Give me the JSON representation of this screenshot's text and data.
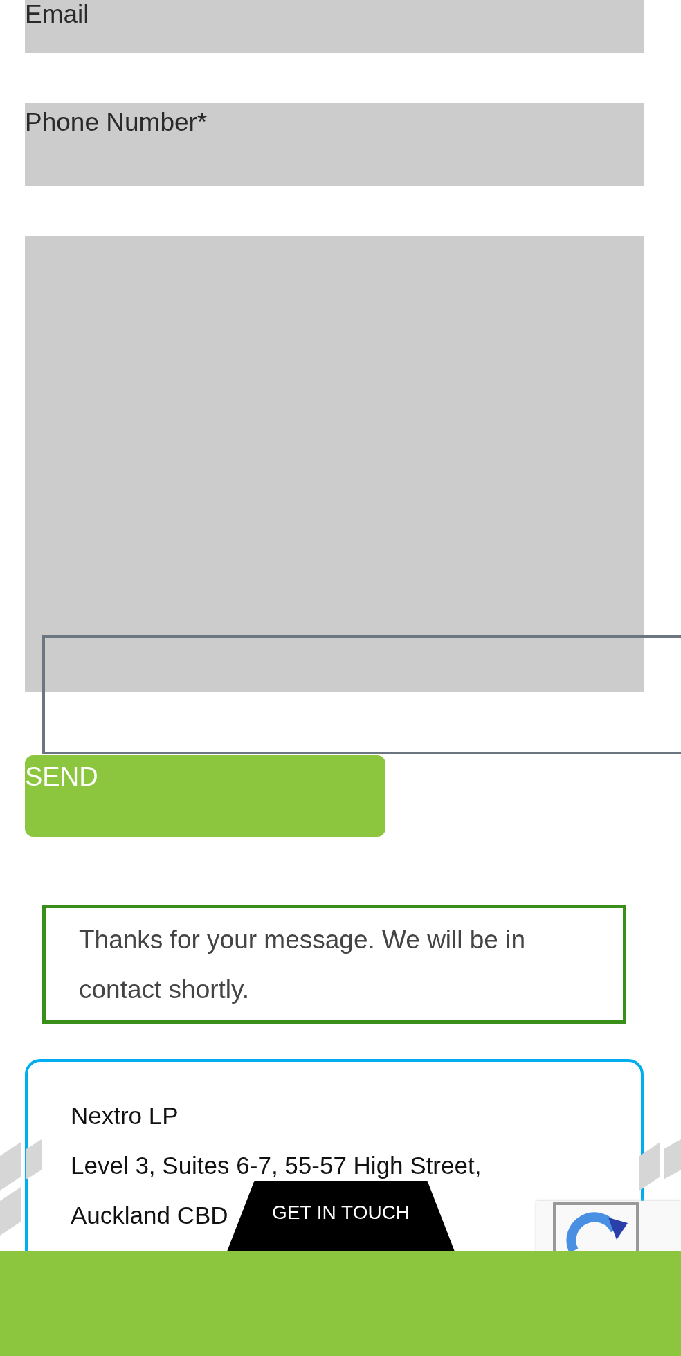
{
  "form": {
    "fields": [
      {
        "kind": "input",
        "placeholder": "Email"
      },
      {
        "kind": "input",
        "placeholder": "Phone Number*"
      },
      {
        "kind": "textarea"
      }
    ],
    "submit_button": "SEND"
  },
  "confirmation": "Thanks for your message. We will be in contact shortly.",
  "address_card": {
    "lines": [
      "Nextro LP",
      "Level 3, Suites 6-7, 55-57 High Street,",
      "Auckland CBD"
    ]
  },
  "contact_tab": "GET IN TOUCH"
}
